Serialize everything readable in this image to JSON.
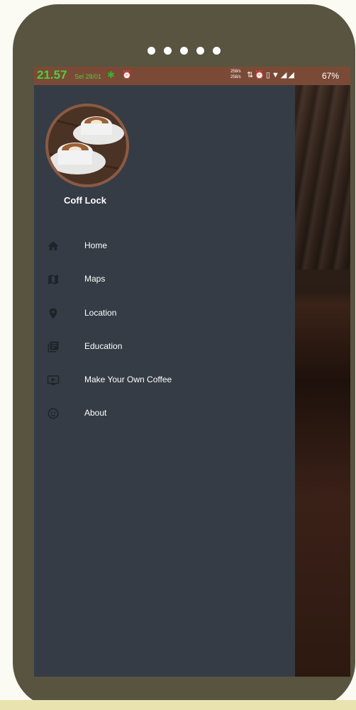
{
  "status_bar": {
    "time": "21.57",
    "date": "Sel 28/01",
    "speed_up": "258/s",
    "speed_down": "258/s",
    "battery": "67%"
  },
  "drawer": {
    "app_name": "Coff Lock",
    "items": [
      {
        "label": "Home",
        "icon": "home-icon"
      },
      {
        "label": "Maps",
        "icon": "map-icon"
      },
      {
        "label": "Location",
        "icon": "location-pin-icon"
      },
      {
        "label": "Education",
        "icon": "library-books-icon"
      },
      {
        "label": "Make Your Own Coffee",
        "icon": "video-play-icon"
      },
      {
        "label": "About",
        "icon": "smiley-icon"
      }
    ]
  },
  "colors": {
    "drawer_bg": "#353c45",
    "phone_frame": "#58543f",
    "status_bar": "#7a4a37",
    "time_text": "#4ccf3a"
  }
}
